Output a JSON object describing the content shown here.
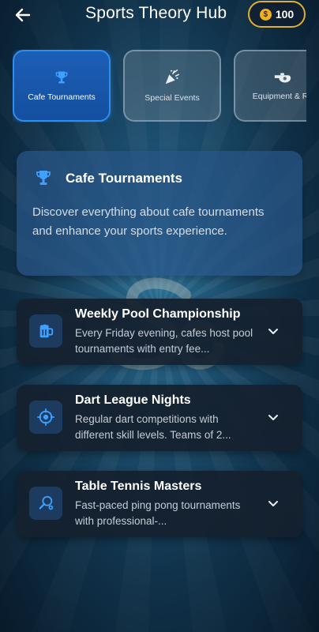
{
  "header": {
    "title": "Sports Theory Hub",
    "back_icon": "arrow-left-icon",
    "coins": {
      "symbol": "$",
      "amount": "100",
      "icon": "coin-icon"
    }
  },
  "tabs": [
    {
      "label": "Cafe Tournaments",
      "icon": "trophy-icon",
      "active": true
    },
    {
      "label": "Special Events",
      "icon": "party-popper-icon",
      "active": false
    },
    {
      "label": "Equipment & Ru",
      "icon": "whistle-icon",
      "active": false
    }
  ],
  "info_card": {
    "icon": "trophy-icon",
    "title": "Cafe Tournaments",
    "description": "Discover everything about cafe tournaments and enhance your sports experience."
  },
  "items": [
    {
      "icon": "beer-mug-icon",
      "title": "Weekly Pool Championship",
      "description": "Every Friday evening, cafes host pool tournaments with entry fee..."
    },
    {
      "icon": "target-icon",
      "title": "Dart League Nights",
      "description": "Regular dart competitions with different skill levels. Teams of 2..."
    },
    {
      "icon": "ping-pong-icon",
      "title": "Table Tennis Masters",
      "description": "Fast-paced ping pong tournaments with professional-..."
    }
  ],
  "colors": {
    "accent": "#2f8cf0",
    "coin_border": "#e0b12a",
    "card_bg": "#14202e",
    "info_card_bg": "#285587"
  }
}
